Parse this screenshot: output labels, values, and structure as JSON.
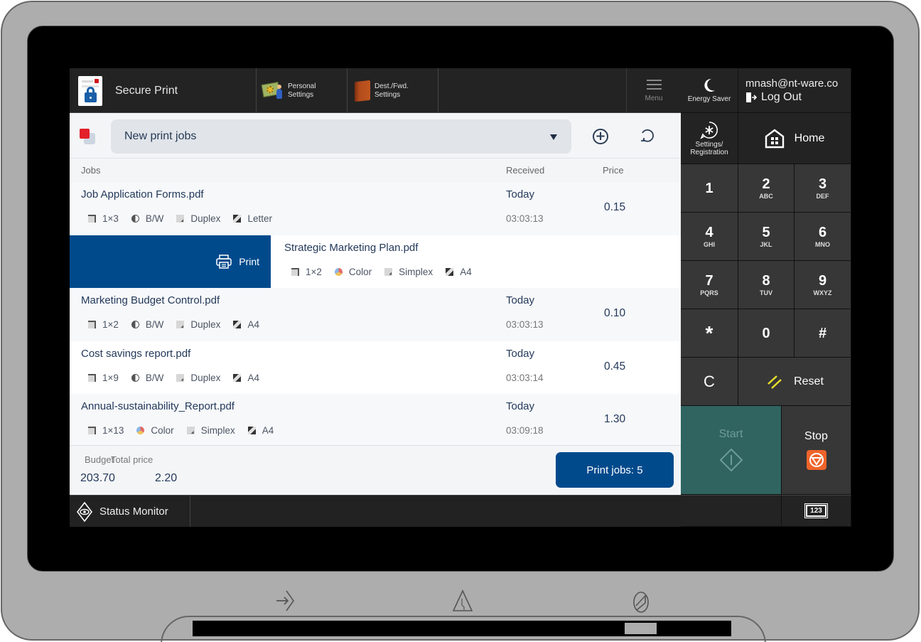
{
  "header": {
    "app_title": "Secure Print",
    "shortcuts": [
      {
        "label_line1": "Personal",
        "label_line2": "Settings",
        "icon": "personal-settings-icon"
      },
      {
        "label_line1": "Dest./Fwd.",
        "label_line2": "Settings",
        "icon": "address-book-icon"
      }
    ],
    "menu_label": "Menu"
  },
  "selector": {
    "value": "New print jobs",
    "add_icon": "plus-circle-icon",
    "refresh_icon": "refresh-icon"
  },
  "columns": {
    "jobs": "Jobs",
    "received": "Received",
    "price": "Price"
  },
  "swipe_action": {
    "label": "Print",
    "icon": "printer-icon"
  },
  "jobs": [
    {
      "name": "Job Application Forms.pdf",
      "copies": "1×3",
      "color": "B/W",
      "sides": "Duplex",
      "paper": "Letter",
      "day": "Today",
      "time": "03:03:13",
      "price": "0.15"
    },
    {
      "name": "Strategic Marketing Plan.pdf",
      "copies": "1×2",
      "color": "Color",
      "sides": "Simplex",
      "paper": "A4",
      "day": "",
      "time": "",
      "price": ""
    },
    {
      "name": "Marketing Budget Control.pdf",
      "copies": "1×2",
      "color": "B/W",
      "sides": "Duplex",
      "paper": "A4",
      "day": "Today",
      "time": "03:03:13",
      "price": "0.10"
    },
    {
      "name": "Cost savings report.pdf",
      "copies": "1×9",
      "color": "B/W",
      "sides": "Duplex",
      "paper": "A4",
      "day": "Today",
      "time": "03:03:14",
      "price": "0.45"
    },
    {
      "name": "Annual-sustainability_Report.pdf",
      "copies": "1×13",
      "color": "Color",
      "sides": "Simplex",
      "paper": "A4",
      "day": "Today",
      "time": "03:09:18",
      "price": "1.30"
    }
  ],
  "footer": {
    "budget_label": "Budget",
    "budget_value": "203.70",
    "total_label": "Total price",
    "total_value": "2.20",
    "print_jobs_button": "Print jobs: 5"
  },
  "status_bar": {
    "status_monitor": "Status Monitor"
  },
  "right_panel": {
    "energy_saver": "Energy Saver",
    "user_email": "mnash@nt-ware.co",
    "logout": "Log Out",
    "settings_line1": "Settings/",
    "settings_line2": "Registration",
    "home": "Home",
    "keypad": [
      {
        "num": "1",
        "sub": ""
      },
      {
        "num": "2",
        "sub": "ABC"
      },
      {
        "num": "3",
        "sub": "DEF"
      },
      {
        "num": "4",
        "sub": "GHI"
      },
      {
        "num": "5",
        "sub": "JKL"
      },
      {
        "num": "6",
        "sub": "MNO"
      },
      {
        "num": "7",
        "sub": "PQRS"
      },
      {
        "num": "8",
        "sub": "TUV"
      },
      {
        "num": "9",
        "sub": "WXYZ"
      },
      {
        "num": "*",
        "sub": ""
      },
      {
        "num": "0",
        "sub": ""
      },
      {
        "num": "#",
        "sub": ""
      }
    ],
    "clear": "C",
    "reset": "Reset",
    "start": "Start",
    "stop": "Stop",
    "keyboard_toggle": "123"
  },
  "colors": {
    "accent_blue": "#004a8c",
    "start_green": "#2f6460",
    "stop_orange": "#f0642a",
    "reset_yellow": "#e8e02a"
  }
}
